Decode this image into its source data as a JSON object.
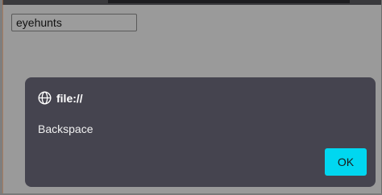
{
  "input": {
    "value": "eyehunts"
  },
  "dialog": {
    "origin": "file://",
    "message": "Backspace",
    "ok_label": "OK",
    "icon": "globe-icon",
    "accent_color": "#00d7f0",
    "background_color": "#45444f"
  }
}
